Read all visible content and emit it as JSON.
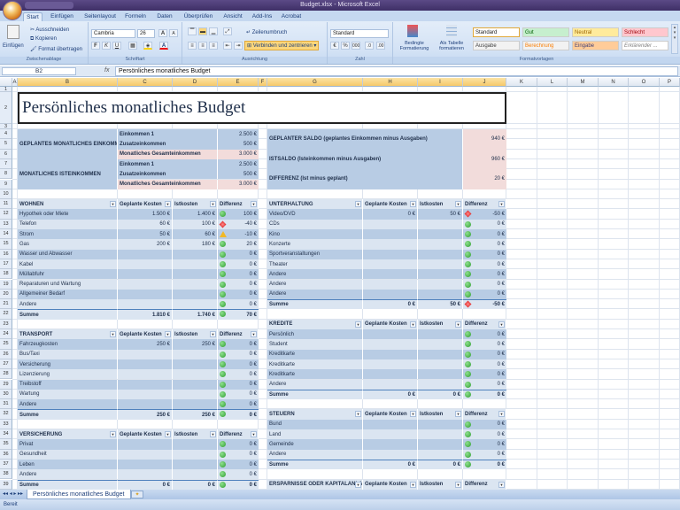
{
  "window": {
    "title": "Budget.xlsx - Microsoft Excel"
  },
  "ribbon": {
    "tabs": [
      "Start",
      "Einfügen",
      "Seitenlayout",
      "Formeln",
      "Daten",
      "Überprüfen",
      "Ansicht",
      "Add-Ins",
      "Acrobat"
    ],
    "clipboard": {
      "paste": "Einfügen",
      "cut": "Ausschneiden",
      "copy": "Kopieren",
      "format_painter": "Format übertragen",
      "label": "Zwischenablage"
    },
    "font": {
      "name": "Cambria",
      "size": "26",
      "bold": "F",
      "italic": "K",
      "underline": "U",
      "grow": "A",
      "shrink": "A",
      "color": "A",
      "label": "Schriftart"
    },
    "alignment": {
      "wrap": "Zeilenumbruch",
      "merge": "Verbinden und zentrieren",
      "label": "Ausrichtung"
    },
    "number": {
      "format": "Standard",
      "percent": "%",
      "thousands": "000",
      "label": "Zahl"
    },
    "styles": {
      "conditional": "Bedingte Formatierung",
      "as_table": "Als Tabelle formatieren",
      "label": "Formatvorlagen",
      "items": [
        {
          "label": "Standard",
          "bg": "#ffffff",
          "fg": "#222222"
        },
        {
          "label": "Gut",
          "bg": "#c6efce",
          "fg": "#006100"
        },
        {
          "label": "Neutral",
          "bg": "#ffeb9c",
          "fg": "#9c6500"
        },
        {
          "label": "Schlecht",
          "bg": "#ffc7ce",
          "fg": "#9c0006"
        },
        {
          "label": "Ausgabe",
          "bg": "#f2f2f2",
          "fg": "#3f3f3f"
        },
        {
          "label": "Berechnung",
          "bg": "#f2f2f2",
          "fg": "#fa7d00"
        },
        {
          "label": "Eingabe",
          "bg": "#ffcc99",
          "fg": "#3f3f76"
        },
        {
          "label": "Erklärender ...",
          "bg": "#ffffff",
          "fg": "#7f7f7f"
        }
      ]
    }
  },
  "formula_bar": {
    "name_box": "B2",
    "fx": "fx",
    "content": "Persönliches monatliches Budget"
  },
  "columns": [
    "A",
    "B",
    "C",
    "D",
    "E",
    "F",
    "G",
    "H",
    "I",
    "J",
    "K",
    "L",
    "M",
    "N",
    "O",
    "P"
  ],
  "sheet": {
    "title": "Persönliches monatliches Budget",
    "income": {
      "planned_label": "GEPLANTES MONATLICHES EINKOMMEN",
      "actual_label": "MONATLICHES ISTEINKOMMEN",
      "planned": [
        {
          "label": "Einkommen 1",
          "value": "2.500 €"
        },
        {
          "label": "Zusatzeinkommen",
          "value": "500 €"
        },
        {
          "label": "Monatliches Gesamteinkommen",
          "value": "3.000 €"
        }
      ],
      "actual": [
        {
          "label": "Einkommen 1",
          "value": "2.500 €"
        },
        {
          "label": "Zusatzeinkommen",
          "value": "500 €"
        },
        {
          "label": "Monatliches Gesamteinkommen",
          "value": "3.000 €"
        }
      ]
    },
    "saldo": [
      {
        "label": "GEPLANTER SALDO (geplantes Einkommen minus Ausgaben)",
        "value": "940 €"
      },
      {
        "label": "ISTSALDO (Isteinkommen minus Ausgaben)",
        "value": "960 €"
      },
      {
        "label": "DIFFERENZ (Ist minus geplant)",
        "value": "20 €"
      }
    ],
    "col_headers": {
      "planned": "Geplante Kosten",
      "actual": "Istkosten",
      "diff": "Differenz"
    },
    "tables": [
      {
        "name": "WOHNEN",
        "side": "left",
        "row": 11,
        "rows": [
          {
            "label": "Hypothek oder Miete",
            "planned": "1.500 €",
            "actual": "1.400 €",
            "status": "green",
            "diff": "100 €"
          },
          {
            "label": "Telefon",
            "planned": "60 €",
            "actual": "100 €",
            "status": "red",
            "diff": "-40 €"
          },
          {
            "label": "Strom",
            "planned": "50 €",
            "actual": "60 €",
            "status": "yellow",
            "diff": "-10 €"
          },
          {
            "label": "Gas",
            "planned": "200 €",
            "actual": "180 €",
            "status": "green",
            "diff": "20 €"
          },
          {
            "label": "Wasser und Abwasser",
            "planned": "",
            "actual": "",
            "status": "green",
            "diff": "0 €"
          },
          {
            "label": "Kabel",
            "planned": "",
            "actual": "",
            "status": "green",
            "diff": "0 €"
          },
          {
            "label": "Müllabfuhr",
            "planned": "",
            "actual": "",
            "status": "green",
            "diff": "0 €"
          },
          {
            "label": "Reparaturen und Wartung",
            "planned": "",
            "actual": "",
            "status": "green",
            "diff": "0 €"
          },
          {
            "label": "Allgemeiner Bedarf",
            "planned": "",
            "actual": "",
            "status": "green",
            "diff": "0 €"
          },
          {
            "label": "Andere",
            "planned": "",
            "actual": "",
            "status": "green",
            "diff": "0 €"
          }
        ],
        "sum": {
          "label": "Summe",
          "planned": "1.810 €",
          "actual": "1.740 €",
          "status": "green",
          "diff": "70 €"
        }
      },
      {
        "name": "TRANSPORT",
        "side": "left",
        "row": 24,
        "rows": [
          {
            "label": "Fahrzeugkosten",
            "planned": "250 €",
            "actual": "250 €",
            "status": "green",
            "diff": "0 €"
          },
          {
            "label": "Bus/Taxi",
            "planned": "",
            "actual": "",
            "status": "green",
            "diff": "0 €"
          },
          {
            "label": "Versicherung",
            "planned": "",
            "actual": "",
            "status": "green",
            "diff": "0 €"
          },
          {
            "label": "Lizenzierung",
            "planned": "",
            "actual": "",
            "status": "green",
            "diff": "0 €"
          },
          {
            "label": "Treibstoff",
            "planned": "",
            "actual": "",
            "status": "green",
            "diff": "0 €"
          },
          {
            "label": "Wartung",
            "planned": "",
            "actual": "",
            "status": "green",
            "diff": "0 €"
          },
          {
            "label": "Andere",
            "planned": "",
            "actual": "",
            "status": "green",
            "diff": "0 €"
          }
        ],
        "sum": {
          "label": "Summe",
          "planned": "250 €",
          "actual": "250 €",
          "status": "green",
          "diff": "0 €"
        }
      },
      {
        "name": "VERSICHERUNG",
        "side": "left",
        "row": 34,
        "rows": [
          {
            "label": "Privat",
            "planned": "",
            "actual": "",
            "status": "green",
            "diff": "0 €"
          },
          {
            "label": "Gesundheit",
            "planned": "",
            "actual": "",
            "status": "green",
            "diff": "0 €"
          },
          {
            "label": "Leben",
            "planned": "",
            "actual": "",
            "status": "green",
            "diff": "0 €"
          },
          {
            "label": "Andere",
            "planned": "",
            "actual": "",
            "status": "green",
            "diff": "0 €"
          }
        ],
        "sum": {
          "label": "Summe",
          "planned": "0 €",
          "actual": "0 €",
          "status": "green",
          "diff": "0 €"
        }
      },
      {
        "name": "UNTERHALTUNG",
        "side": "right",
        "row": 11,
        "rows": [
          {
            "label": "Video/DVD",
            "planned": "0 €",
            "actual": "50 €",
            "status": "red",
            "diff": "-50 €"
          },
          {
            "label": "CDs",
            "planned": "",
            "actual": "",
            "status": "green",
            "diff": "0 €"
          },
          {
            "label": "Kino",
            "planned": "",
            "actual": "",
            "status": "green",
            "diff": "0 €"
          },
          {
            "label": "Konzerte",
            "planned": "",
            "actual": "",
            "status": "green",
            "diff": "0 €"
          },
          {
            "label": "Sportveranstaltungen",
            "planned": "",
            "actual": "",
            "status": "green",
            "diff": "0 €"
          },
          {
            "label": "Theater",
            "planned": "",
            "actual": "",
            "status": "green",
            "diff": "0 €"
          },
          {
            "label": "Andere",
            "planned": "",
            "actual": "",
            "status": "green",
            "diff": "0 €"
          },
          {
            "label": "Andere",
            "planned": "",
            "actual": "",
            "status": "green",
            "diff": "0 €"
          },
          {
            "label": "Andere",
            "planned": "",
            "actual": "",
            "status": "green",
            "diff": "0 €"
          }
        ],
        "sum": {
          "label": "Summe",
          "planned": "0 €",
          "actual": "50 €",
          "status": "red",
          "diff": "-50 €"
        }
      },
      {
        "name": "KREDITE",
        "side": "right",
        "row": 23,
        "rows": [
          {
            "label": "Persönlich",
            "planned": "",
            "actual": "",
            "status": "green",
            "diff": "0 €"
          },
          {
            "label": "Student",
            "planned": "",
            "actual": "",
            "status": "green",
            "diff": "0 €"
          },
          {
            "label": "Kreditkarte",
            "planned": "",
            "actual": "",
            "status": "green",
            "diff": "0 €"
          },
          {
            "label": "Kreditkarte",
            "planned": "",
            "actual": "",
            "status": "green",
            "diff": "0 €"
          },
          {
            "label": "Kreditkarte",
            "planned": "",
            "actual": "",
            "status": "green",
            "diff": "0 €"
          },
          {
            "label": "Andere",
            "planned": "",
            "actual": "",
            "status": "green",
            "diff": "0 €"
          }
        ],
        "sum": {
          "label": "Summe",
          "planned": "0 €",
          "actual": "0 €",
          "status": "green",
          "diff": "0 €"
        }
      },
      {
        "name": "STEUERN",
        "side": "right",
        "row": 32,
        "rows": [
          {
            "label": "Bund",
            "planned": "",
            "actual": "",
            "status": "green",
            "diff": "0 €"
          },
          {
            "label": "Land",
            "planned": "",
            "actual": "",
            "status": "green",
            "diff": "0 €"
          },
          {
            "label": "Gemeinde",
            "planned": "",
            "actual": "",
            "status": "green",
            "diff": "0 €"
          },
          {
            "label": "Andere",
            "planned": "",
            "actual": "",
            "status": "green",
            "diff": "0 €"
          }
        ],
        "sum": {
          "label": "Summe",
          "planned": "0 €",
          "actual": "0 €",
          "status": "green",
          "diff": "0 €"
        }
      },
      {
        "name": "ERSPARNISSE ODER KAPITALANLAGEN",
        "side": "right",
        "row": 39,
        "rows": [],
        "sum": null
      }
    ]
  },
  "sheet_tabs": [
    "Persönliches monatliches Budget"
  ],
  "status": "Bereit"
}
